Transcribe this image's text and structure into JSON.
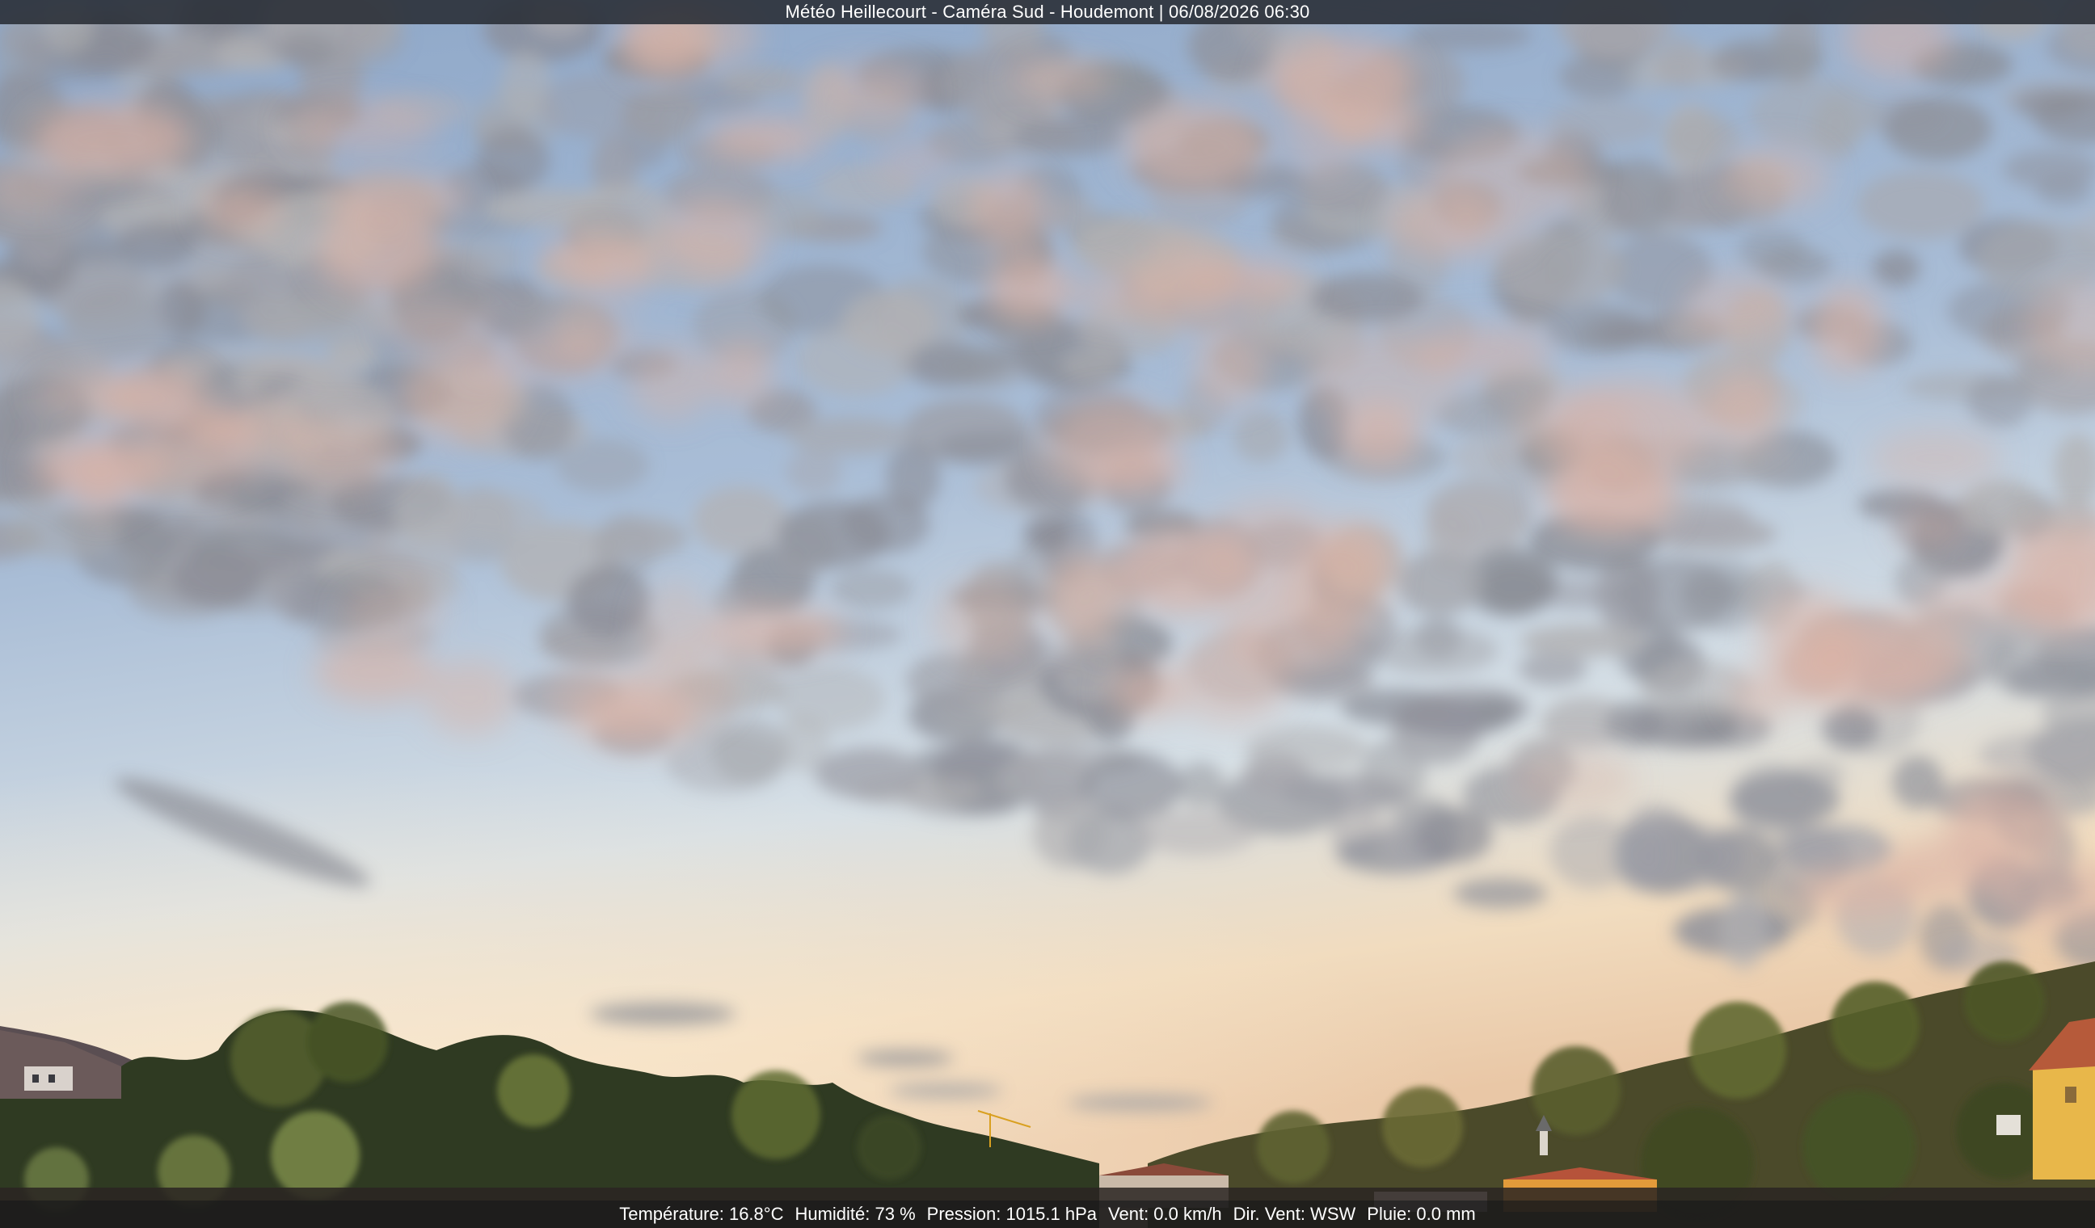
{
  "header": {
    "caption": "Météo Heillecourt - Caméra Sud - Houdemont | 06/08/2026 06:30"
  },
  "weather": {
    "temperature": "Température: 16.8°C",
    "humidity": "Humidité: 73 %",
    "pressure": "Pression: 1015.1 hPa",
    "wind_speed": "Vent: 0.0 km/h",
    "wind_direction": "Dir. Vent: WSW",
    "rain": "Pluie: 0.0 mm"
  },
  "scene": {
    "subject": "morning-sky-with-altocumulus-clouds",
    "colors": {
      "sky_top": "#8ea7c8",
      "sky_mid": "#a9bdd6",
      "horizon_glow": "#f1dcbf",
      "cloud_gray": "#8f929b",
      "cloud_pink": "#d9b3a6",
      "tree_dark": "#2f3a22",
      "tree_light": "#6d7a3a",
      "building_yellow": "#e8b74a"
    }
  }
}
